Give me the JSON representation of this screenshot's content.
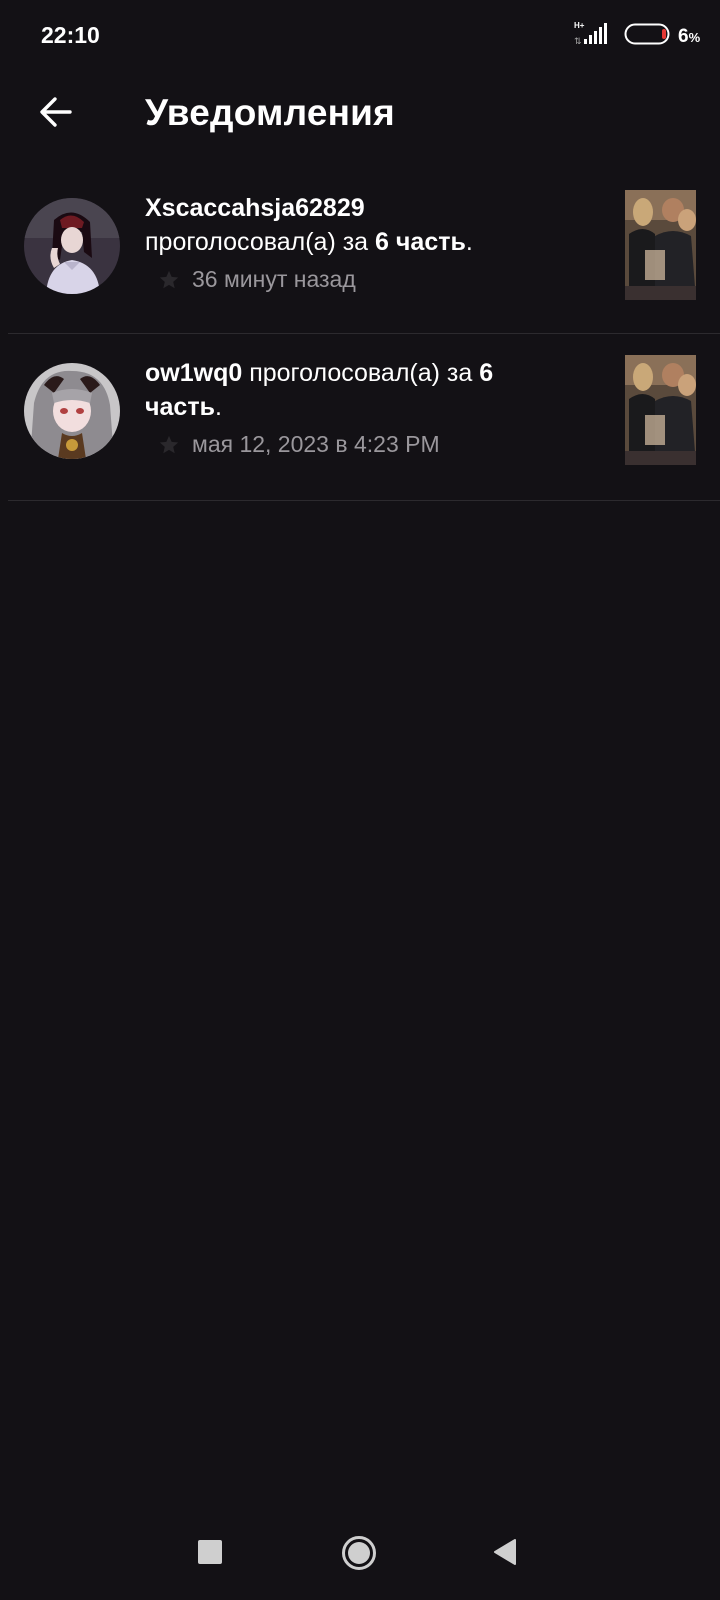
{
  "status_bar": {
    "time": "22:10",
    "network": "H+",
    "battery_percent": "6",
    "battery_unit": "%"
  },
  "app_bar": {
    "back_icon": "arrow-left-icon",
    "title": "Уведомления"
  },
  "notifications": [
    {
      "username": "Xscaccahsja62829",
      "action": "проголосовал(а) за",
      "part": "6 часть",
      "suffix": ".",
      "time": "36 минут назад"
    },
    {
      "username": "ow1wq0",
      "action": "проголосовал(а) за",
      "part": "6 часть",
      "suffix": ".",
      "time": "мая 12, 2023 в 4:23 PM"
    }
  ],
  "nav_bar": {
    "recents_icon": "square-icon",
    "home_icon": "circle-icon",
    "back_icon": "triangle-back-icon"
  },
  "colors": {
    "background": "#131115",
    "text": "#ffffff",
    "secondary_text": "#9a979c",
    "divider": "#2c2a2e",
    "battery_low": "#e53935"
  }
}
